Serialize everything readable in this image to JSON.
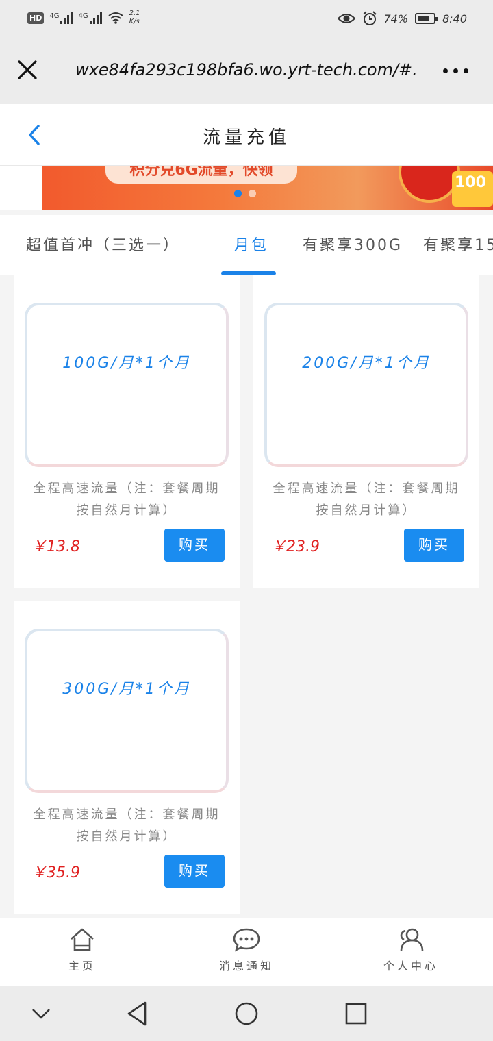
{
  "status_bar": {
    "hd": "HD",
    "net1": "4G",
    "net2": "4G",
    "speed_value": "2.1",
    "speed_unit": "K/s",
    "battery": "74%",
    "battery_level": 0.74,
    "time": "8:40"
  },
  "browser": {
    "url": "wxe84fa293c198bfa6.wo.yrt-tech.com/#..."
  },
  "header": {
    "title": "流量充值"
  },
  "banner": {
    "text": "积分兑6G流量，快领",
    "badge": "100",
    "active_dot": 0,
    "dot_count": 2
  },
  "tabs": [
    {
      "label": "超值首冲（三选一）",
      "active": false
    },
    {
      "label": "月包",
      "active": true
    },
    {
      "label": "有聚享300G",
      "active": false
    },
    {
      "label": "有聚享15",
      "active": false
    }
  ],
  "products": [
    {
      "name": "100G/月*1个月",
      "desc": "全程高速流量（注：套餐周期按自然月计算）",
      "price": "￥13.8",
      "buy": "购买"
    },
    {
      "name": "200G/月*1个月",
      "desc": "全程高速流量（注：套餐周期按自然月计算）",
      "price": "￥23.9",
      "buy": "购买"
    },
    {
      "name": "300G/月*1个月",
      "desc": "全程高速流量（注：套餐周期按自然月计算）",
      "price": "￥35.9",
      "buy": "购买"
    }
  ],
  "bottom_nav": [
    {
      "label": "主页",
      "icon": "home-icon"
    },
    {
      "label": "消息通知",
      "icon": "message-icon"
    },
    {
      "label": "个人中心",
      "icon": "user-icon"
    }
  ],
  "colors": {
    "accent": "#1a82e8",
    "price": "#e02020",
    "buy_button": "#1a8cf0"
  }
}
